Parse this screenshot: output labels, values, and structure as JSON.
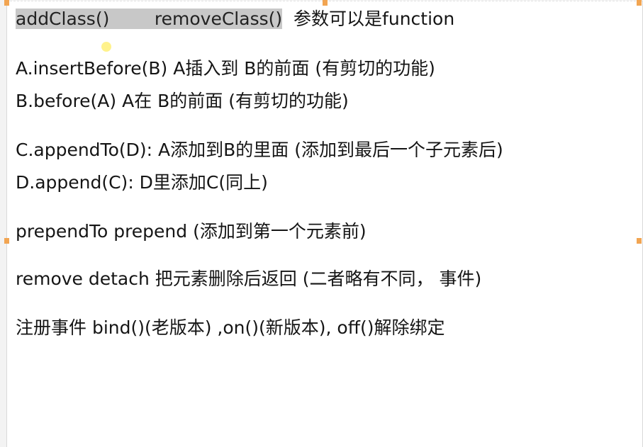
{
  "accent_color": "#f2a552",
  "highlight_color": "#c8c8c8",
  "line1": {
    "add_class": "addClass()",
    "remove_class": "removeClass()",
    "note": "参数可以是function"
  },
  "line2": "A.insertBefore(B)  A插入到 B的前面 (有剪切的功能)",
  "line3": "B.before(A)  A在 B的前面 (有剪切的功能)",
  "line4": "C.appendTo(D): A添加到B的里面 (添加到最后一个子元素后)",
  "line5": "D.append(C): D里添加C(同上)",
  "line6": "prependTo  prepend (添加到第一个元素前)",
  "line7": "remove  detach 把元素删除后返回  (二者略有不同，  事件)",
  "line8": "注册事件 bind()(老版本) ,on()(新版本),  off()解除绑定"
}
